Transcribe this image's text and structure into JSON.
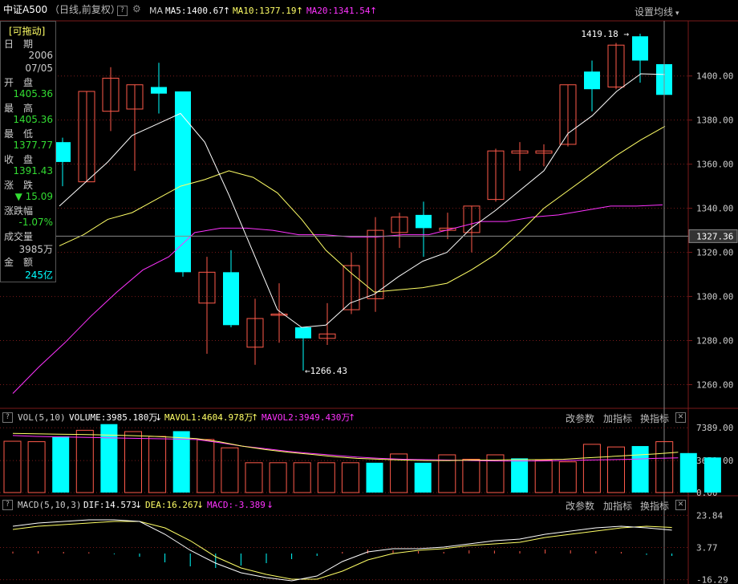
{
  "header": {
    "index_name": "中证A500",
    "period": "（日线,前复权）",
    "question_icon": "?",
    "gear_icon": "gear-icon",
    "ma_label": "MA",
    "ma5": "MA5:1400.67",
    "ma10": "MA10:1377.19",
    "ma20": "MA20:1341.54",
    "arrow": "↑",
    "settings": "设置均线",
    "settings_caret": "▾"
  },
  "info_panel": {
    "draggable": "[可拖动]",
    "date_label": "日　期",
    "year": "2006",
    "date": "07/05",
    "open_label": "开　盘",
    "open": "1405.36",
    "high_label": "最　高",
    "high": "1405.36",
    "low_label": "最　低",
    "low": "1377.77",
    "close_label": "收　盘",
    "close": "1391.43",
    "change_label": "涨　跌",
    "change": "▼ 15.09",
    "pct_label": "涨跌幅",
    "pct": "-1.07%",
    "volume_label": "成交量",
    "volume": "3985万",
    "amount_label": "金　额",
    "amount": "245亿"
  },
  "volume_header": {
    "question_icon": "?",
    "name": "VOL(5,10)",
    "volume": "VOLUME:3985.180万",
    "down_arrow": "↓",
    "up_arrow": "↑",
    "mavol1": "MAVOL1:4604.978万",
    "mavol2": "MAVOL2:3949.430万"
  },
  "macd_header": {
    "question_icon": "?",
    "name": "MACD(5,10,3)",
    "dif": "DIF:14.573",
    "dea": "DEA:16.267",
    "macd": "MACD:-3.389",
    "down_arrow": "↓"
  },
  "panel_buttons": {
    "change_params": "改参数",
    "add_indicator": "加指标",
    "switch_indicator": "换指标",
    "close": "✕"
  },
  "colors": {
    "up": "#ff5a4a",
    "down": "#00ffff",
    "ma5": "#ffffff",
    "ma10": "#ffff66",
    "ma20": "#ff33ff",
    "grid": "#7a1a1a",
    "price_label": "#cccccc"
  },
  "chart_data": [
    {
      "type": "candlestick",
      "title": "中证A500",
      "y_ticks": [
        1260,
        1280,
        1300,
        1320,
        1340,
        1360,
        1380,
        1400
      ],
      "ylim": [
        1250,
        1425
      ],
      "crosshair_price": "1327.36",
      "max_label": "1419.18",
      "min_label": "1266.43",
      "candles": [
        {
          "open": 1370,
          "close": 1361,
          "high": 1372,
          "low": 1350
        },
        {
          "open": 1352,
          "close": 1393,
          "high": 1393,
          "low": 1352
        },
        {
          "open": 1384,
          "close": 1399,
          "high": 1404,
          "low": 1375
        },
        {
          "open": 1385,
          "close": 1396,
          "high": 1396,
          "low": 1357
        },
        {
          "open": 1395,
          "close": 1392,
          "high": 1406,
          "low": 1383
        },
        {
          "open": 1393,
          "close": 1311,
          "high": 1393,
          "low": 1309
        },
        {
          "open": 1297,
          "close": 1311,
          "high": 1318,
          "low": 1274
        },
        {
          "open": 1311,
          "close": 1287,
          "high": 1321,
          "low": 1286
        },
        {
          "open": 1277,
          "close": 1290,
          "high": 1299,
          "low": 1269
        },
        {
          "open": 1292,
          "close": 1292,
          "high": 1306,
          "low": 1279
        },
        {
          "open": 1286,
          "close": 1281,
          "high": 1286,
          "low": 1266.43
        },
        {
          "open": 1281,
          "close": 1283,
          "high": 1297,
          "low": 1278
        },
        {
          "open": 1294,
          "close": 1314,
          "high": 1320,
          "low": 1292
        },
        {
          "open": 1299,
          "close": 1330,
          "high": 1336,
          "low": 1293
        },
        {
          "open": 1329,
          "close": 1336,
          "high": 1338,
          "low": 1322
        },
        {
          "open": 1337,
          "close": 1331,
          "high": 1343,
          "low": 1318
        },
        {
          "open": 1330,
          "close": 1331,
          "high": 1338,
          "low": 1326
        },
        {
          "open": 1329,
          "close": 1341,
          "high": 1341,
          "low": 1320
        },
        {
          "open": 1344,
          "close": 1366,
          "high": 1367,
          "low": 1343
        },
        {
          "open": 1365,
          "close": 1366,
          "high": 1370,
          "low": 1357
        },
        {
          "open": 1365,
          "close": 1366,
          "high": 1369,
          "low": 1359
        },
        {
          "open": 1369,
          "close": 1396,
          "high": 1396,
          "low": 1368
        },
        {
          "open": 1402,
          "close": 1394,
          "high": 1407,
          "low": 1384
        },
        {
          "open": 1395,
          "close": 1414,
          "high": 1415,
          "low": 1394
        },
        {
          "open": 1418,
          "close": 1407,
          "high": 1419.18,
          "low": 1397
        },
        {
          "open": 1405.36,
          "close": 1391.43,
          "high": 1405.36,
          "low": 1377.77
        }
      ],
      "ma5": [
        1341,
        1351,
        1361,
        1373,
        1378,
        1383,
        1370,
        1346,
        1320,
        1294,
        1286,
        1287,
        1297,
        1301,
        1309,
        1316,
        1320,
        1331,
        1339,
        1348,
        1357,
        1374,
        1382,
        1393,
        1401,
        1400.67
      ],
      "ma10": [
        1323,
        1328,
        1335,
        1338,
        1344,
        1350,
        1353,
        1357,
        1354,
        1347,
        1335,
        1321,
        1311,
        1302,
        1303,
        1304,
        1306,
        1312,
        1319,
        1329,
        1340,
        1348,
        1356,
        1364,
        1371,
        1377.19
      ],
      "ma20": [
        1256,
        1268,
        1279,
        1291,
        1302,
        1312,
        1318,
        1329,
        1331,
        1331,
        1330,
        1328,
        1328,
        1327,
        1327,
        1328,
        1328,
        1331,
        1334,
        1334,
        1336,
        1337,
        1339,
        1341,
        1341,
        1341.54
      ]
    },
    {
      "type": "bar",
      "title": "VOL(5,10)",
      "y_ticks": [
        0,
        3651,
        7389
      ],
      "y_tick_labels": [
        "0.00",
        "3651.00",
        "7389.00"
      ],
      "ylim": [
        0,
        7500
      ],
      "values": [
        5850,
        5800,
        6400,
        7100,
        7800,
        6950,
        6400,
        7000,
        6050,
        5100,
        3400,
        3400,
        3400,
        3400,
        3400,
        3400,
        4400,
        3400,
        4300,
        3800,
        4300,
        3900,
        3700,
        3500,
        5500,
        5200,
        5300,
        5800,
        4500,
        4000
      ],
      "mavol1": [
        6750,
        6700,
        6660,
        6620,
        6570,
        6500,
        6420,
        6300,
        6150,
        5800,
        5300,
        4900,
        4600,
        4350,
        4100,
        3900,
        3800,
        3700,
        3650,
        3650,
        3700,
        3700,
        3750,
        3750,
        3800,
        3950,
        4100,
        4250,
        4400,
        4604.978
      ],
      "mavol2": [
        6500,
        6400,
        6350,
        6300,
        6250,
        6200,
        6150,
        6100,
        6050,
        5700,
        5300,
        5000,
        4700,
        4450,
        4250,
        4050,
        3900,
        3800,
        3750,
        3700,
        3650,
        3600,
        3600,
        3600,
        3650,
        3700,
        3750,
        3800,
        3900,
        3949.43
      ]
    },
    {
      "type": "bar",
      "title": "MACD(5,10,3)",
      "y_ticks": [
        -16.29,
        3.77,
        23.84
      ],
      "y_tick_labels": [
        "-16.29",
        "3.77",
        "23.84"
      ],
      "ylim": [
        -17,
        25
      ],
      "values": [
        1.2,
        1.5,
        1.0,
        0.8,
        -0.5,
        -2.0,
        -5.5,
        -8.0,
        -9.0,
        -7.5,
        -6.0,
        -3.5,
        -1.5,
        1.0,
        2.5,
        2.0,
        1.5,
        1.0,
        2.0,
        1.8,
        1.5,
        2.5,
        2.0,
        1.5,
        1.0,
        -0.8,
        -1.5
      ],
      "dif": [
        17,
        19,
        20,
        21,
        21,
        20,
        12,
        2,
        -6,
        -12,
        -15,
        -17,
        -14,
        -5,
        1,
        3,
        3,
        4,
        6,
        8,
        9,
        12,
        14,
        16,
        17,
        16,
        14.573
      ],
      "dea": [
        15,
        17,
        18,
        19,
        20,
        20,
        16,
        8,
        -2,
        -9,
        -13,
        -16,
        -16,
        -11,
        -4,
        0,
        2,
        3,
        5,
        6,
        7,
        10,
        12,
        14,
        16,
        17,
        16.267
      ]
    }
  ]
}
